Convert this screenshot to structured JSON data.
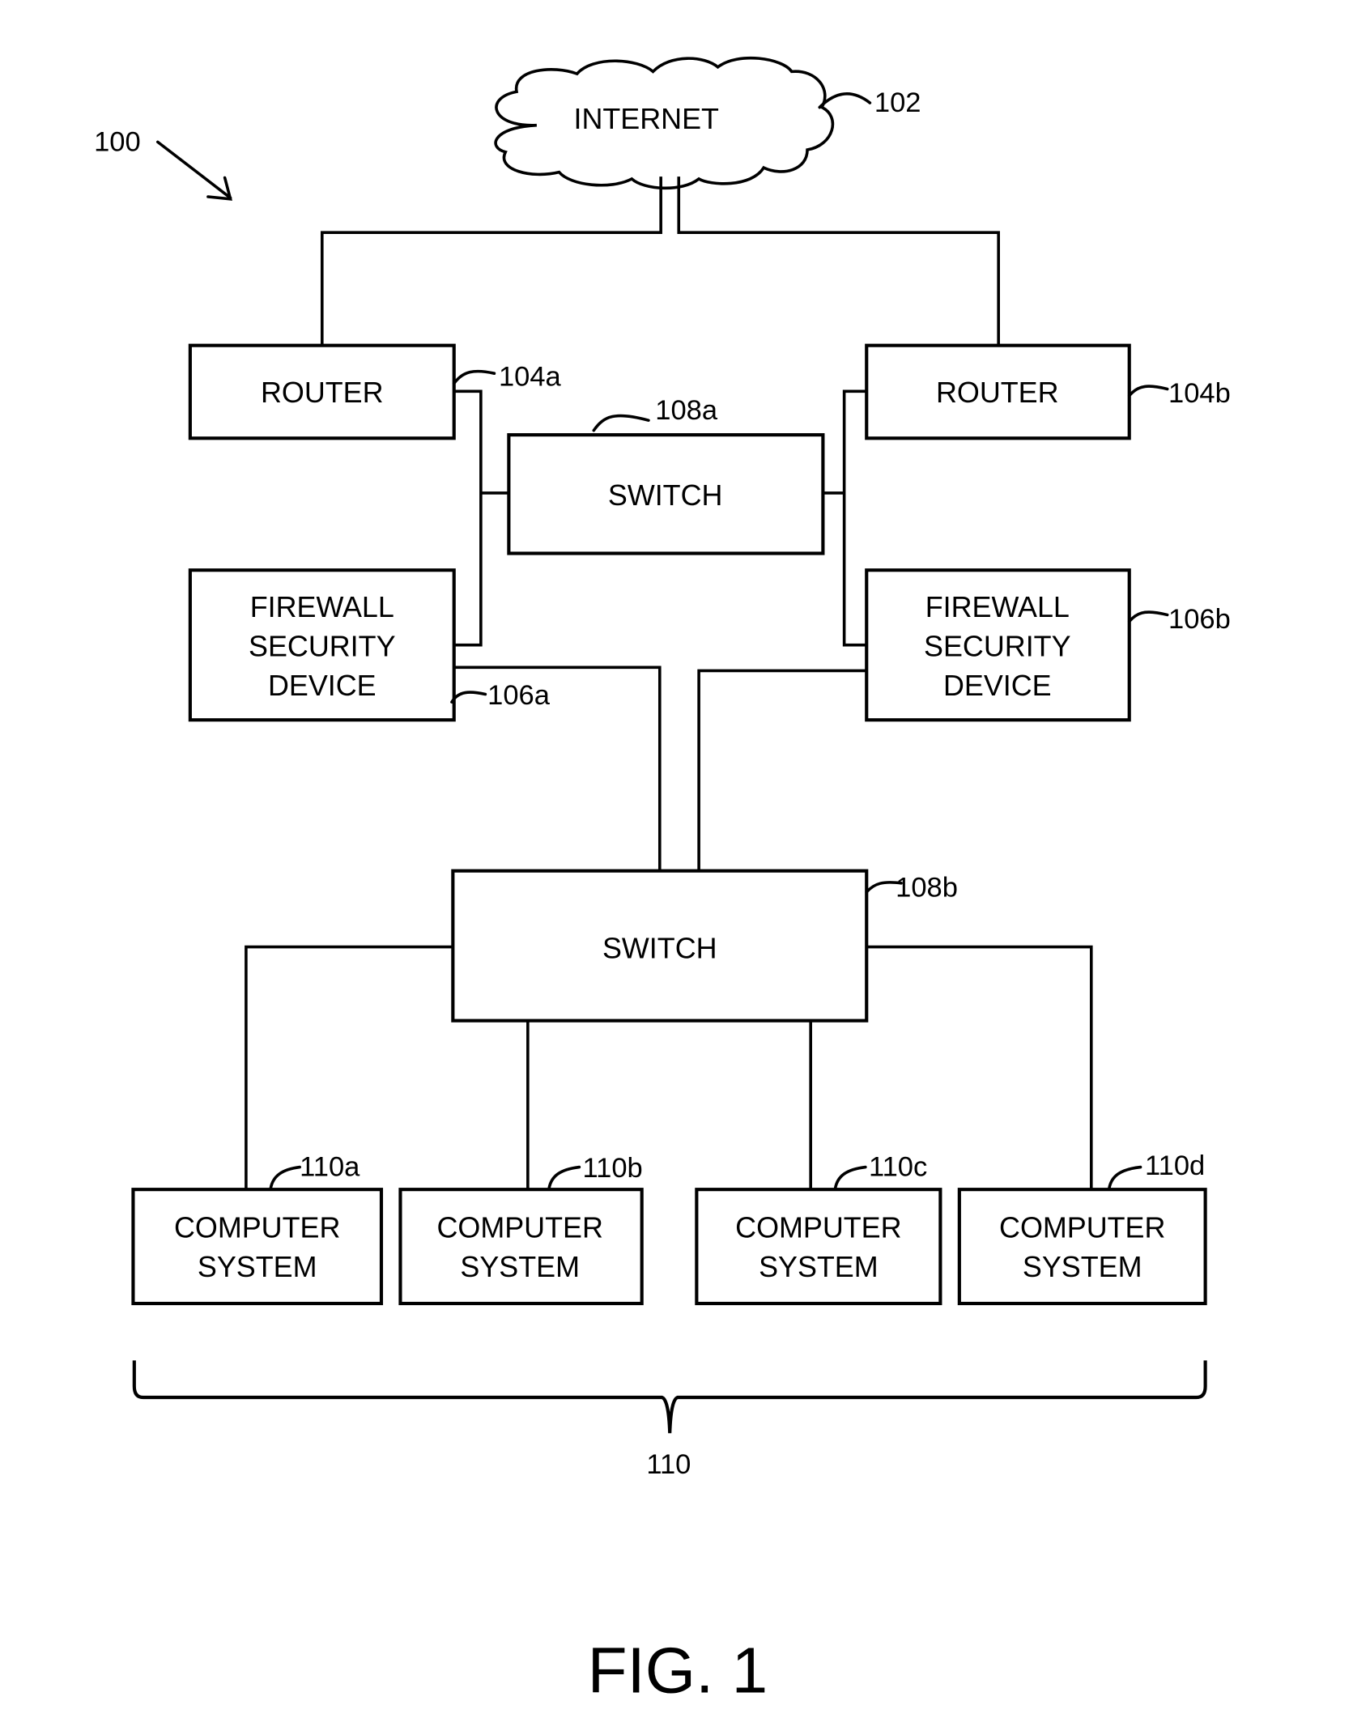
{
  "figure": {
    "caption": "FIG. 1",
    "system_ref": "100"
  },
  "internet": {
    "label": "INTERNET",
    "ref": "102"
  },
  "routers": [
    {
      "label": "ROUTER",
      "ref": "104a"
    },
    {
      "label": "ROUTER",
      "ref": "104b"
    }
  ],
  "firewalls": [
    {
      "lines": [
        "FIREWALL",
        "SECURITY",
        "DEVICE"
      ],
      "ref": "106a"
    },
    {
      "lines": [
        "FIREWALL",
        "SECURITY",
        "DEVICE"
      ],
      "ref": "106b"
    }
  ],
  "switches": [
    {
      "label": "SWITCH",
      "ref": "108a"
    },
    {
      "label": "SWITCH",
      "ref": "108b"
    }
  ],
  "computers": [
    {
      "lines": [
        "COMPUTER",
        "SYSTEM"
      ],
      "ref": "110a"
    },
    {
      "lines": [
        "COMPUTER",
        "SYSTEM"
      ],
      "ref": "110b"
    },
    {
      "lines": [
        "COMPUTER",
        "SYSTEM"
      ],
      "ref": "110c"
    },
    {
      "lines": [
        "COMPUTER",
        "SYSTEM"
      ],
      "ref": "110d"
    }
  ],
  "computer_group": {
    "ref": "110"
  }
}
